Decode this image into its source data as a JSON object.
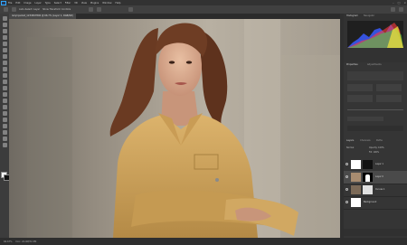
{
  "app": {
    "menus": [
      "File",
      "Edit",
      "Image",
      "Layer",
      "Type",
      "Select",
      "Filter",
      "3D",
      "View",
      "Plugins",
      "Window",
      "Help"
    ]
  },
  "options": {
    "text1": "Auto-Select: Layer",
    "text2": "Show Transform Controls"
  },
  "document": {
    "tab_title": "ladyinjacket_1234567890 @ 66.7% (Layer 1, RGB/8#)"
  },
  "panels": {
    "histogram_tab": "Histogram",
    "histogram_sub": "Navigator",
    "properties_tab": "Properties",
    "adjustments_tab": "Adjustments",
    "layers_tab": "Layers",
    "channels_tab": "Channels",
    "paths_tab": "Paths",
    "blend_mode": "Normal",
    "opacity": "Opacity: 100%",
    "fill": "Fill: 100%",
    "layers": [
      {
        "name": "Layer 1"
      },
      {
        "name": "Layer 0"
      },
      {
        "name": "Curves 1"
      },
      {
        "name": "Background"
      }
    ]
  },
  "status": {
    "zoom": "66.67%",
    "info": "Doc: 24.9M/72.3M"
  },
  "colors": {
    "accent": "#31a8ff",
    "jacket": "#d2a75f",
    "bg": "#a39a8c"
  }
}
